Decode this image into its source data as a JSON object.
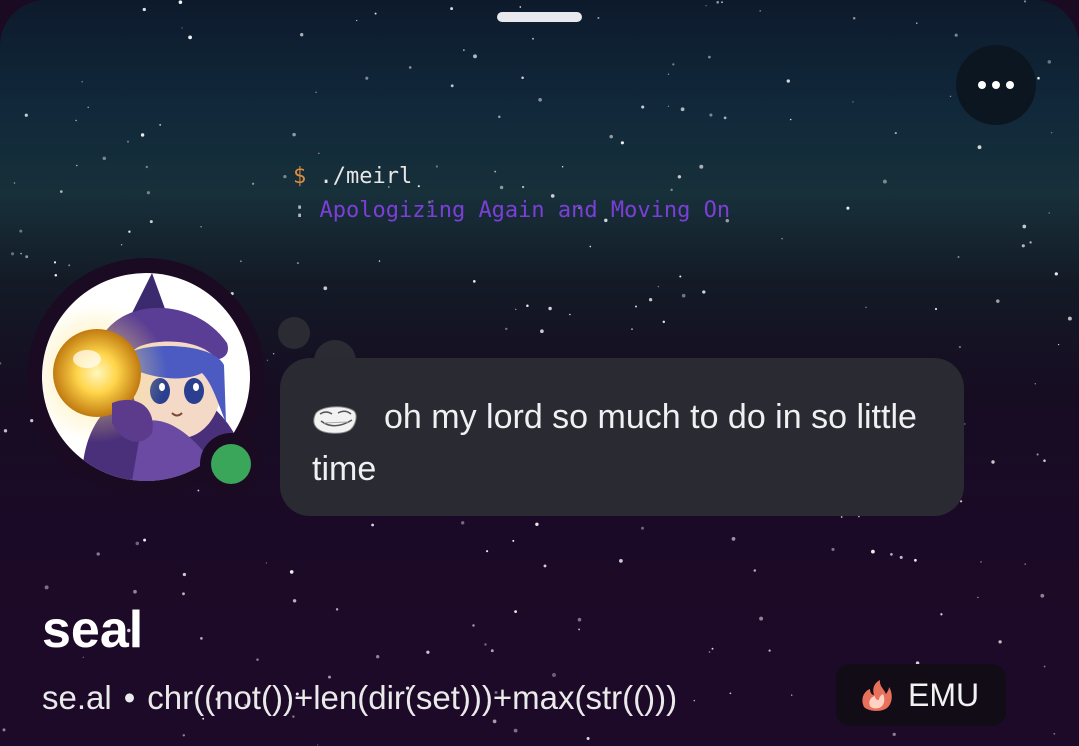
{
  "banner": {
    "terminal_prompt_symbol": "$",
    "terminal_command": "./meirl",
    "terminal_output_symbol": ":",
    "terminal_output": "Apologizing Again and Moving On"
  },
  "header": {
    "more_icon": "more-horizontal-icon"
  },
  "profile": {
    "status": "online",
    "status_color": "#3aa65a",
    "bubble_emoji": "troll-face-icon",
    "bubble_text": "oh my lord so much to do in so little time",
    "display_name": "seal",
    "username": "se.al",
    "separator": "•",
    "pronouns": "chr((not())+len(dir(set)))+max(str(()))",
    "guild_tag": {
      "icon": "flame-icon",
      "label": "EMU"
    }
  },
  "colors": {
    "terminal_output": "#7b3fd8",
    "terminal_prompt": "#d98c3f",
    "background": "#1a0b22"
  }
}
